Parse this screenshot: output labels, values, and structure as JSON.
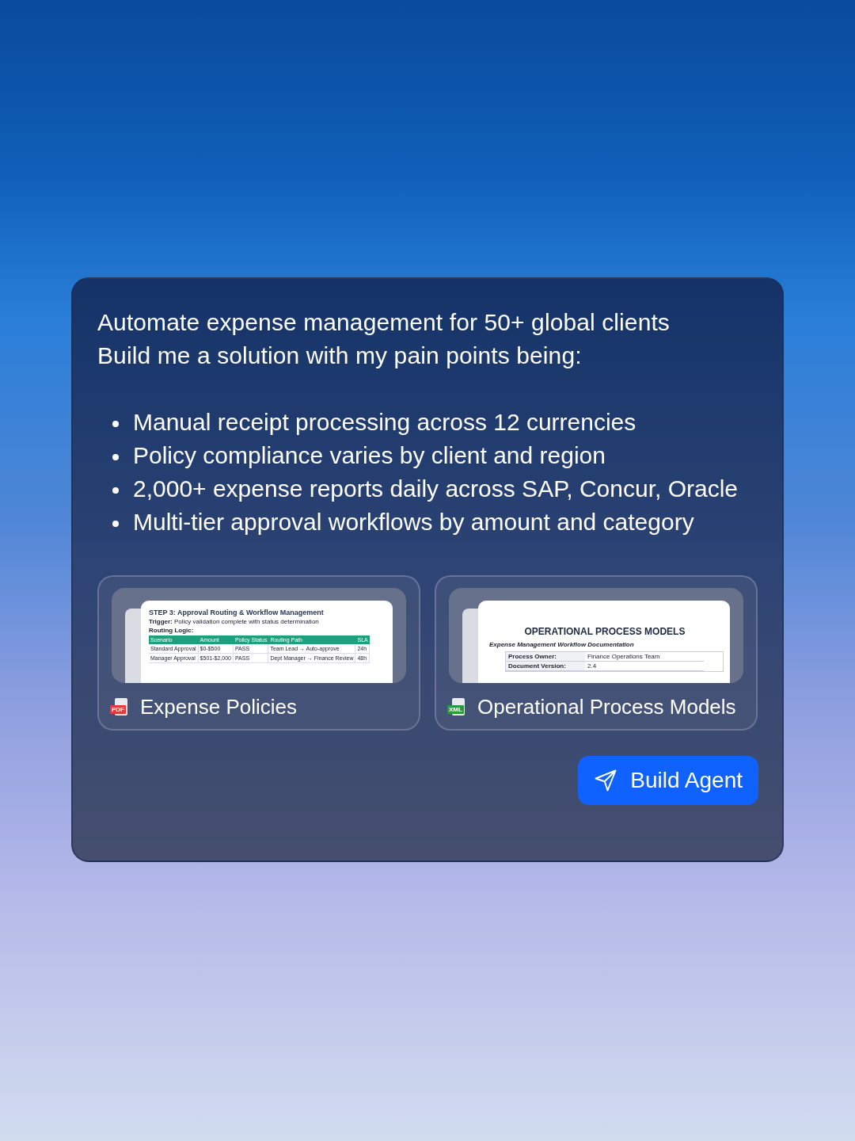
{
  "prompt": {
    "lines": [
      "Automate expense management for 50+ global clients",
      "Build me a solution with my pain points being:"
    ],
    "bullets": [
      "Manual receipt processing across 12 currencies",
      "Policy compliance varies by client and region",
      "2,000+ expense reports daily across SAP, Concur, Oracle",
      "Multi-tier approval workflows by amount and category"
    ]
  },
  "attachments": [
    {
      "name": "Expense Policies",
      "color": "#e53a3a",
      "badge": "PDF",
      "preview": {
        "kind": "step_doc",
        "heading": "STEP 3: Approval Routing & Workflow Management",
        "trigger_label": "Trigger:",
        "trigger_text": "Policy validation complete with status determination",
        "section": "Routing Logic:",
        "columns": [
          "Scenario",
          "Amount",
          "Policy Status",
          "Routing Path",
          "SLA"
        ],
        "rows": [
          [
            "Standard Approval",
            "$0-$500",
            "PASS",
            "Team Lead → Auto-approve",
            "24h"
          ],
          [
            "Manager Approval",
            "$501-$2,000",
            "PASS",
            "Dept Manager → Finance Review",
            "48h"
          ]
        ]
      }
    },
    {
      "name": "Operational Process Models",
      "color": "#2c9a3c",
      "badge": "XML",
      "preview": {
        "kind": "title_doc",
        "title": "OPERATIONAL PROCESS MODELS",
        "subtitle": "Expense Management Workflow Documentation",
        "rows": [
          [
            "Process Owner:",
            "Finance Operations Team"
          ],
          [
            "Document Version:",
            "2.4"
          ]
        ]
      }
    }
  ],
  "build_button": {
    "label": "Build Agent"
  }
}
